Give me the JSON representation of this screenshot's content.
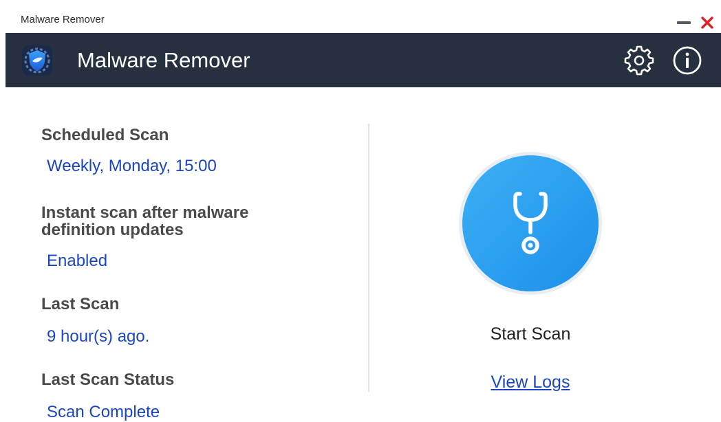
{
  "window": {
    "title": "Malware Remover",
    "minimize_icon": "minimize-icon",
    "close_icon": "close-icon",
    "close_color": "#e02020"
  },
  "header": {
    "title": "Malware Remover",
    "logo_icon": "shield-logo-icon",
    "settings_icon": "gear-icon",
    "info_icon": "info-icon",
    "background": "#27303f"
  },
  "status": {
    "scheduled_scan_label": "Scheduled Scan",
    "scheduled_scan_value": "Weekly, Monday, 15:00",
    "instant_scan_label_line1": "Instant scan after malware",
    "instant_scan_label_line2": "definition updates",
    "instant_scan_value": "Enabled",
    "last_scan_label": "Last Scan",
    "last_scan_value": "9 hour(s) ago.",
    "last_scan_status_label": "Last Scan Status",
    "last_scan_status_value": "Scan Complete",
    "value_color": "#1a46c4"
  },
  "scan": {
    "button_icon": "stethoscope-icon",
    "button_color": "#2196f3",
    "start_label": "Start Scan",
    "view_logs_label": "View Logs"
  }
}
